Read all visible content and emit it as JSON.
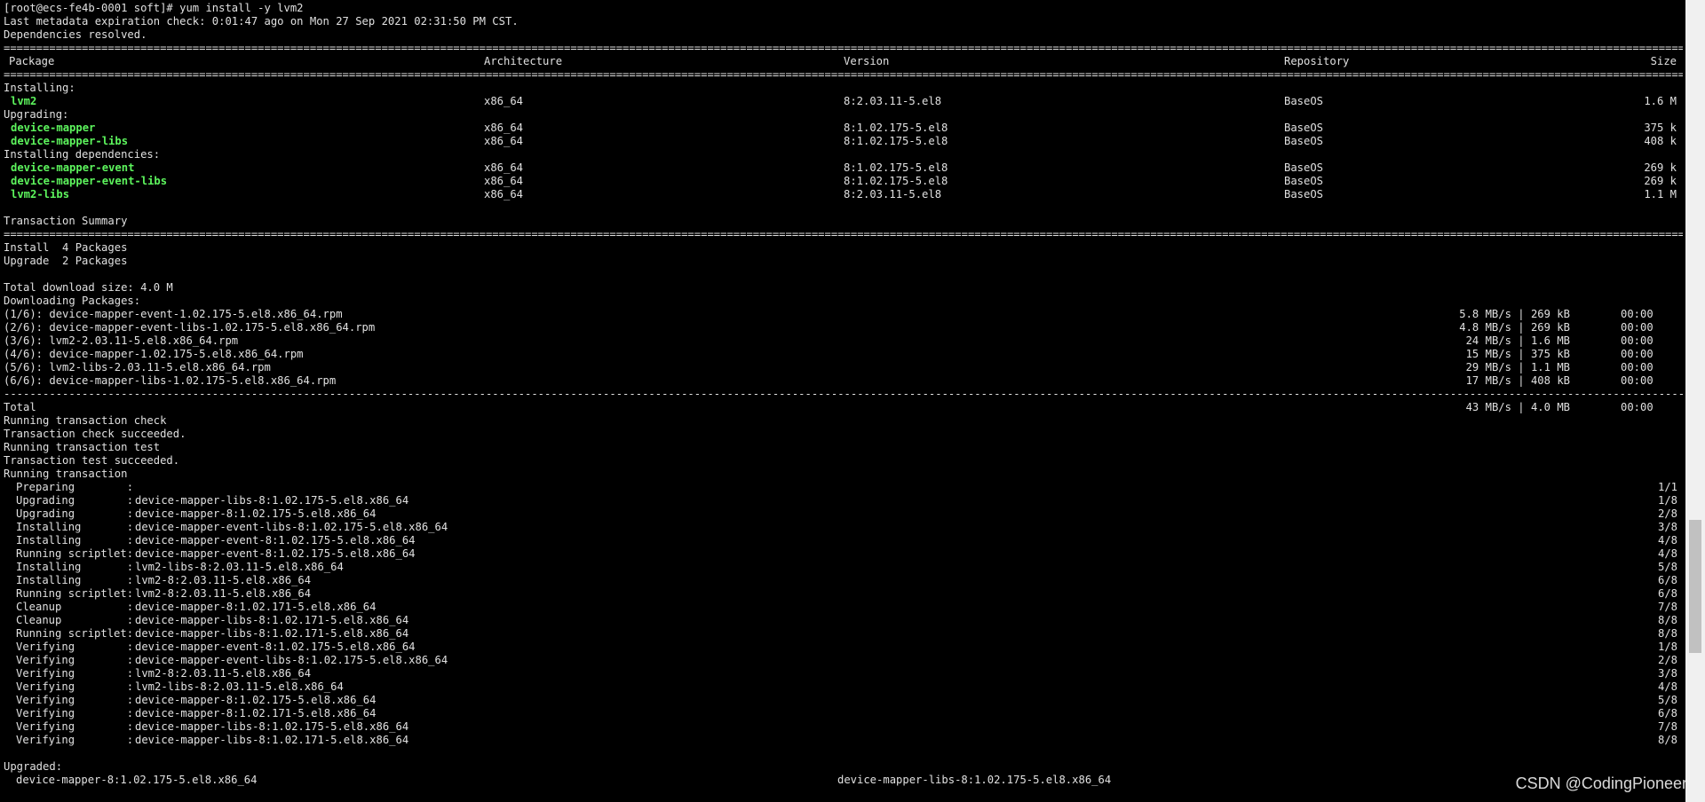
{
  "header": [
    "[root@ecs-fe4b-0001 soft]# yum install -y lvm2",
    "Last metadata expiration check: 0:01:47 ago on Mon 27 Sep 2021 02:31:50 PM CST.",
    "Dependencies resolved."
  ],
  "rule_chars": {
    "heavy": "=",
    "light": "-"
  },
  "table_headers": {
    "package": "Package",
    "arch": "Architecture",
    "version": "Version",
    "repo": "Repository",
    "size": "Size"
  },
  "groups": [
    {
      "title": "Installing:",
      "rows": [
        {
          "package": "lvm2",
          "arch": "x86_64",
          "version": "8:2.03.11-5.el8",
          "repo": "BaseOS",
          "size": "1.6 M"
        }
      ]
    },
    {
      "title": "Upgrading:",
      "rows": [
        {
          "package": "device-mapper",
          "arch": "x86_64",
          "version": "8:1.02.175-5.el8",
          "repo": "BaseOS",
          "size": "375 k"
        },
        {
          "package": "device-mapper-libs",
          "arch": "x86_64",
          "version": "8:1.02.175-5.el8",
          "repo": "BaseOS",
          "size": "408 k"
        }
      ]
    },
    {
      "title": "Installing dependencies:",
      "rows": [
        {
          "package": "device-mapper-event",
          "arch": "x86_64",
          "version": "8:1.02.175-5.el8",
          "repo": "BaseOS",
          "size": "269 k"
        },
        {
          "package": "device-mapper-event-libs",
          "arch": "x86_64",
          "version": "8:1.02.175-5.el8",
          "repo": "BaseOS",
          "size": "269 k"
        },
        {
          "package": "lvm2-libs",
          "arch": "x86_64",
          "version": "8:2.03.11-5.el8",
          "repo": "BaseOS",
          "size": "1.1 M"
        }
      ]
    }
  ],
  "summary": {
    "title": "Transaction Summary",
    "lines": [
      "Install  4 Packages",
      "Upgrade  2 Packages"
    ],
    "total_size": "Total download size: 4.0 M",
    "downloading": "Downloading Packages:"
  },
  "downloads": [
    {
      "name": "(1/6): device-mapper-event-1.02.175-5.el8.x86_64.rpm",
      "rate": "5.8 MB/s | 269 kB",
      "time": "00:00"
    },
    {
      "name": "(2/6): device-mapper-event-libs-1.02.175-5.el8.x86_64.rpm",
      "rate": "4.8 MB/s | 269 kB",
      "time": "00:00"
    },
    {
      "name": "(3/6): lvm2-2.03.11-5.el8.x86_64.rpm",
      "rate": "24 MB/s | 1.6 MB",
      "time": "00:00"
    },
    {
      "name": "(4/6): device-mapper-1.02.175-5.el8.x86_64.rpm",
      "rate": "15 MB/s | 375 kB",
      "time": "00:00"
    },
    {
      "name": "(5/6): lvm2-libs-2.03.11-5.el8.x86_64.rpm",
      "rate": "29 MB/s | 1.1 MB",
      "time": "00:00"
    },
    {
      "name": "(6/6): device-mapper-libs-1.02.175-5.el8.x86_64.rpm",
      "rate": "17 MB/s | 408 kB",
      "time": "00:00"
    }
  ],
  "total": {
    "label": "Total",
    "rate": "43 MB/s | 4.0 MB",
    "time": "00:00"
  },
  "transaction_lines": [
    "Running transaction check",
    "Transaction check succeeded.",
    "Running transaction test",
    "Transaction test succeeded.",
    "Running transaction"
  ],
  "steps": [
    {
      "action": "Preparing",
      "pkg": "",
      "count": "1/1"
    },
    {
      "action": "Upgrading",
      "pkg": "device-mapper-libs-8:1.02.175-5.el8.x86_64",
      "count": "1/8"
    },
    {
      "action": "Upgrading",
      "pkg": "device-mapper-8:1.02.175-5.el8.x86_64",
      "count": "2/8"
    },
    {
      "action": "Installing",
      "pkg": "device-mapper-event-libs-8:1.02.175-5.el8.x86_64",
      "count": "3/8"
    },
    {
      "action": "Installing",
      "pkg": "device-mapper-event-8:1.02.175-5.el8.x86_64",
      "count": "4/8"
    },
    {
      "action": "Running scriptlet",
      "pkg": "device-mapper-event-8:1.02.175-5.el8.x86_64",
      "count": "4/8"
    },
    {
      "action": "Installing",
      "pkg": "lvm2-libs-8:2.03.11-5.el8.x86_64",
      "count": "5/8"
    },
    {
      "action": "Installing",
      "pkg": "lvm2-8:2.03.11-5.el8.x86_64",
      "count": "6/8"
    },
    {
      "action": "Running scriptlet",
      "pkg": "lvm2-8:2.03.11-5.el8.x86_64",
      "count": "6/8"
    },
    {
      "action": "Cleanup",
      "pkg": "device-mapper-8:1.02.171-5.el8.x86_64",
      "count": "7/8"
    },
    {
      "action": "Cleanup",
      "pkg": "device-mapper-libs-8:1.02.171-5.el8.x86_64",
      "count": "8/8"
    },
    {
      "action": "Running scriptlet",
      "pkg": "device-mapper-libs-8:1.02.171-5.el8.x86_64",
      "count": "8/8"
    },
    {
      "action": "Verifying",
      "pkg": "device-mapper-event-8:1.02.175-5.el8.x86_64",
      "count": "1/8"
    },
    {
      "action": "Verifying",
      "pkg": "device-mapper-event-libs-8:1.02.175-5.el8.x86_64",
      "count": "2/8"
    },
    {
      "action": "Verifying",
      "pkg": "lvm2-8:2.03.11-5.el8.x86_64",
      "count": "3/8"
    },
    {
      "action": "Verifying",
      "pkg": "lvm2-libs-8:2.03.11-5.el8.x86_64",
      "count": "4/8"
    },
    {
      "action": "Verifying",
      "pkg": "device-mapper-8:1.02.175-5.el8.x86_64",
      "count": "5/8"
    },
    {
      "action": "Verifying",
      "pkg": "device-mapper-8:1.02.171-5.el8.x86_64",
      "count": "6/8"
    },
    {
      "action": "Verifying",
      "pkg": "device-mapper-libs-8:1.02.175-5.el8.x86_64",
      "count": "7/8"
    },
    {
      "action": "Verifying",
      "pkg": "device-mapper-libs-8:1.02.171-5.el8.x86_64",
      "count": "8/8"
    }
  ],
  "upgraded": {
    "title": "Upgraded:",
    "items": [
      "device-mapper-8:1.02.175-5.el8.x86_64",
      "device-mapper-libs-8:1.02.175-5.el8.x86_64"
    ]
  },
  "watermark": "CSDN @CodingPioneer",
  "scrollbar": {
    "position_fraction": 0.78
  },
  "colors": {
    "background": "#000000",
    "text": "#e0e0e0",
    "package_name": "#5df55d",
    "scrollbar_track": "#f0f0f0",
    "scrollbar_thumb": "#c1c1c1"
  }
}
